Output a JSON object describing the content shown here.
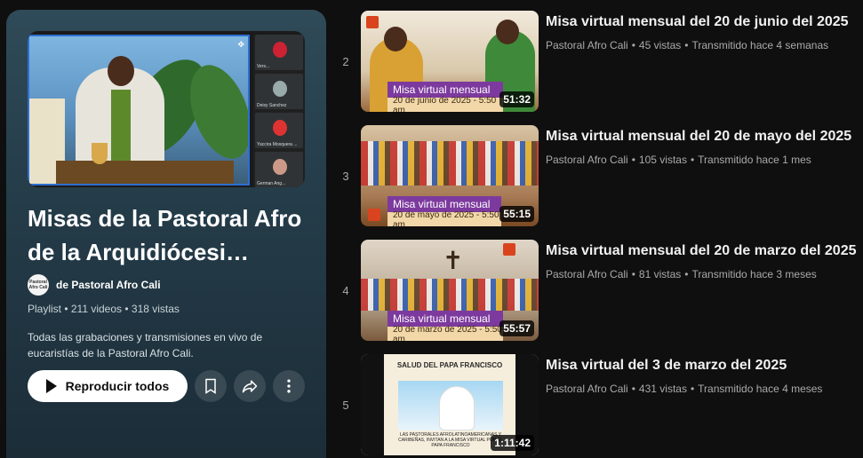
{
  "playlist": {
    "title": "Misas de la Pastoral Afro de la Arquidiócesi…",
    "owner_prefix": "de ",
    "owner_name": "Pastoral Afro Cali",
    "owner_avatar_text": "Pastoral Afro Cali",
    "stats": "Playlist • 211 videos • 318 vistas",
    "description": "Todas las grabaciones y transmisiones en vivo de eucaristías de la Pastoral Afro Cali.",
    "play_all_label": "Reproducir todos",
    "save_icon": "bookmark-icon",
    "share_icon": "share-icon",
    "more_icon": "more-vert-icon",
    "hero_participants": [
      "Vers...",
      "Deisy Sanchez",
      "Yaccira Mosquera ...",
      "German Ang..."
    ]
  },
  "videos": [
    {
      "index": "2",
      "title": "Misa virtual mensual del 20 de junio del 2025",
      "channel": "Pastoral Afro Cali",
      "views": "45 vistas",
      "age": "Transmitido hace 4 semanas",
      "duration": "51:32",
      "banner_top": "Misa virtual mensual",
      "banner_bottom": "20 de junio de 2025 - 5:50 am"
    },
    {
      "index": "3",
      "title": "Misa virtual mensual del 20 de mayo del 2025",
      "channel": "Pastoral Afro Cali",
      "views": "105 vistas",
      "age": "Transmitido hace 1 mes",
      "duration": "55:15",
      "banner_top": "Misa virtual mensual",
      "banner_bottom": "20 de mayo de 2025 - 5:50 am"
    },
    {
      "index": "4",
      "title": "Misa virtual mensual del 20 de marzo del 2025",
      "channel": "Pastoral Afro Cali",
      "views": "81 vistas",
      "age": "Transmitido hace 3 meses",
      "duration": "55:57",
      "banner_top": "Misa virtual mensual",
      "banner_bottom": "20 de marzo de 2025 - 5:50 am"
    },
    {
      "index": "5",
      "title": "Misa virtual del 3 de marzo del 2025",
      "channel": "Pastoral Afro Cali",
      "views": "431 vistas",
      "age": "Transmitido hace 4 meses",
      "duration": "1:11:42",
      "poster_title": "SALUD DEL PAPA FRANCISCO",
      "poster_caption": "LAS PASTORALES AFROLATINOAMERICANAS Y CARIBEÑAS, INVITAN A LA MISA VIRTUAL POR EL PAPA FRANCISCO"
    }
  ],
  "colors": {
    "background": "#0f0f0f",
    "panel": "#2f4a58",
    "text_primary": "#f1f1f1",
    "text_secondary": "#aaaaaa",
    "banner_purple": "#7d3a9e"
  }
}
